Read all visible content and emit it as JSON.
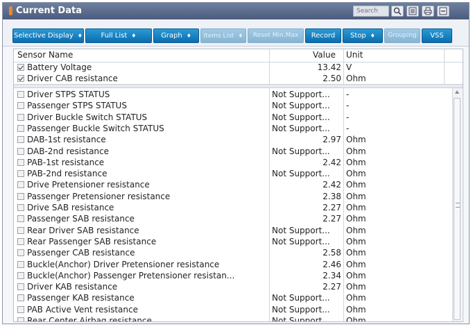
{
  "window": {
    "title": "Current Data",
    "search_placeholder": "Search"
  },
  "toolbar": {
    "buttons": [
      {
        "label": "Selective Display",
        "dropdown": true,
        "enabled": true
      },
      {
        "label": "Full List",
        "dropdown": true,
        "enabled": true
      },
      {
        "label": "Graph",
        "dropdown": true,
        "enabled": true
      },
      {
        "label": "Items List",
        "dropdown": true,
        "enabled": false
      },
      {
        "label": "Reset Min.Max",
        "dropdown": false,
        "enabled": false
      },
      {
        "label": "Record",
        "dropdown": false,
        "enabled": true
      },
      {
        "label": "Stop",
        "dropdown": true,
        "enabled": true
      },
      {
        "label": "Grouping",
        "dropdown": false,
        "enabled": false
      },
      {
        "label": "VSS",
        "dropdown": false,
        "enabled": true
      }
    ]
  },
  "table": {
    "columns": {
      "name": "Sensor Name",
      "value": "Value",
      "unit": "Unit"
    },
    "fixed_rows": [
      {
        "name": "Battery Voltage",
        "value": "13.42",
        "unit": "V",
        "checked": true
      },
      {
        "name": "Driver CAB resistance",
        "value": "2.50",
        "unit": "Ohm",
        "checked": true
      }
    ],
    "rows": [
      {
        "name": "Driver STPS STATUS",
        "value": "Not Support...",
        "unit": "-",
        "checked": false
      },
      {
        "name": "Passenger STPS STATUS",
        "value": "Not Support...",
        "unit": "-",
        "checked": false
      },
      {
        "name": "Driver Buckle Switch STATUS",
        "value": "Not Support...",
        "unit": "-",
        "checked": false
      },
      {
        "name": "Passenger Buckle Switch STATUS",
        "value": "Not Support...",
        "unit": "-",
        "checked": false
      },
      {
        "name": "DAB-1st resistance",
        "value": "2.97",
        "unit": "Ohm",
        "checked": false
      },
      {
        "name": "DAB-2nd resistance",
        "value": "Not Support...",
        "unit": "Ohm",
        "checked": false
      },
      {
        "name": "PAB-1st resistance",
        "value": "2.42",
        "unit": "Ohm",
        "checked": false
      },
      {
        "name": "PAB-2nd resistance",
        "value": "Not Support...",
        "unit": "Ohm",
        "checked": false
      },
      {
        "name": "Drive Pretensioner resistance",
        "value": "2.42",
        "unit": "Ohm",
        "checked": false
      },
      {
        "name": "Passenger Pretensioner resistance",
        "value": "2.38",
        "unit": "Ohm",
        "checked": false
      },
      {
        "name": "Drive SAB resistance",
        "value": "2.27",
        "unit": "Ohm",
        "checked": false
      },
      {
        "name": "Passenger SAB resistance",
        "value": "2.27",
        "unit": "Ohm",
        "checked": false
      },
      {
        "name": "Rear Driver SAB resistance",
        "value": "Not Support...",
        "unit": "Ohm",
        "checked": false
      },
      {
        "name": "Rear Passenger SAB resistance",
        "value": "Not Support...",
        "unit": "Ohm",
        "checked": false
      },
      {
        "name": "Passenger CAB resistance",
        "value": "2.58",
        "unit": "Ohm",
        "checked": false
      },
      {
        "name": "Buckle(Anchor) Driver Pretensioner resistance",
        "value": "2.46",
        "unit": "Ohm",
        "checked": false
      },
      {
        "name": "Buckle(Anchor) Passenger Pretensioner resistan...",
        "value": "2.34",
        "unit": "Ohm",
        "checked": false
      },
      {
        "name": "Driver KAB resistance",
        "value": "2.27",
        "unit": "Ohm",
        "checked": false
      },
      {
        "name": "Passenger KAB resistance",
        "value": "Not Support...",
        "unit": "Ohm",
        "checked": false
      },
      {
        "name": "PAB Active Vent resistance",
        "value": "Not Support...",
        "unit": "Ohm",
        "checked": false
      },
      {
        "name": "Rear Center Airbag resistance",
        "value": "Not Support...",
        "unit": "Ohm",
        "checked": false
      }
    ]
  }
}
